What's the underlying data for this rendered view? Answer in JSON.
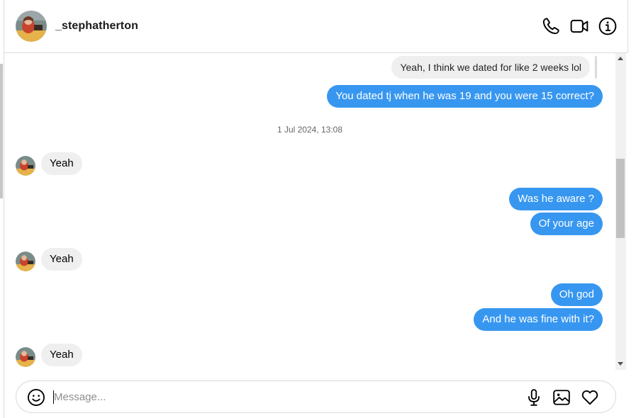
{
  "header": {
    "username": "_stephatherton",
    "icons": [
      "phone-icon",
      "video-camera-icon",
      "info-icon"
    ]
  },
  "thread": {
    "reply_preview": "Yeah, I think we dated for like 2 weeks lol",
    "messages": [
      {
        "from": "me",
        "text": "You dated tj when he was 19 and you were 15 correct?"
      },
      {
        "timestamp": "1 Jul 2024, 13:08"
      },
      {
        "from": "them",
        "text": "Yeah"
      },
      {
        "from": "me",
        "text": "Was he aware ?"
      },
      {
        "from": "me",
        "text": "Of your age"
      },
      {
        "from": "them",
        "text": "Yeah"
      },
      {
        "from": "me",
        "text": "Oh god"
      },
      {
        "from": "me",
        "text": "And he was fine with it?"
      },
      {
        "from": "them",
        "text": "Yeah"
      }
    ]
  },
  "composer": {
    "placeholder": "Message...",
    "value": "",
    "icons": [
      "emoji-icon",
      "microphone-icon",
      "image-icon",
      "heart-icon"
    ]
  },
  "colors": {
    "outgoing_bubble": "#3797f0",
    "incoming_bubble": "#efefef",
    "border": "#dbdbdb"
  }
}
